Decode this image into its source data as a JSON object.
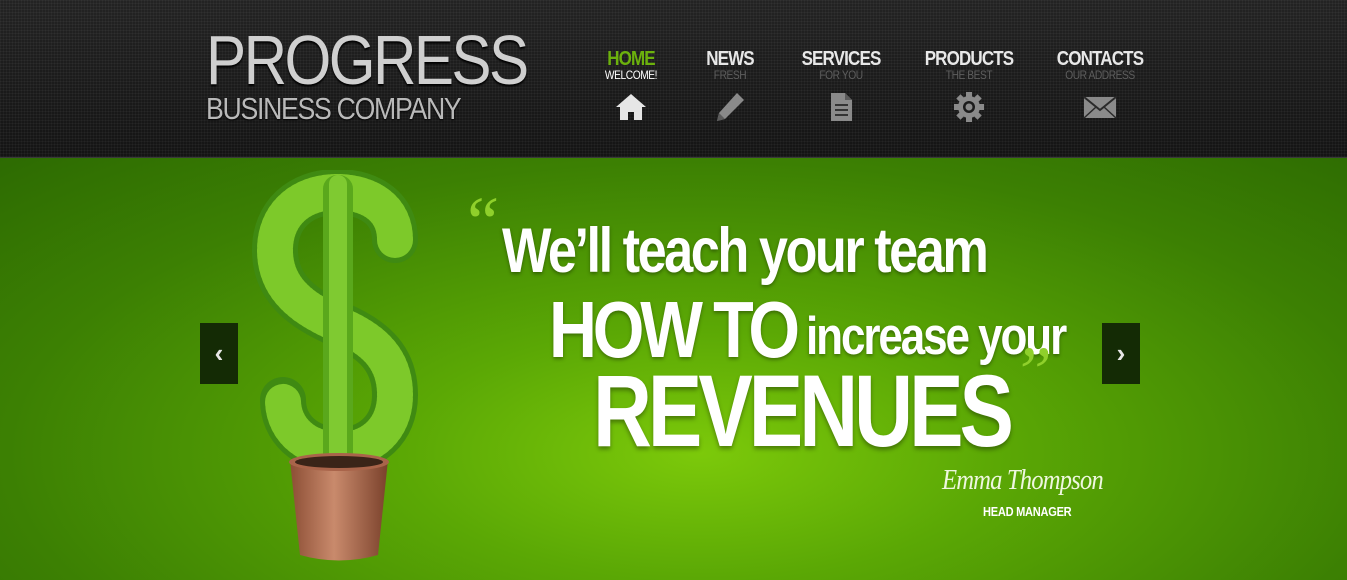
{
  "logo": {
    "title": "PROGRESS",
    "subtitle": "BUSINESS COMPANY"
  },
  "nav": {
    "items": [
      {
        "label": "HOME",
        "sub": "WELCOME!",
        "icon": "home-icon",
        "active": true
      },
      {
        "label": "NEWS",
        "sub": "FRESH",
        "icon": "pencil-icon",
        "active": false
      },
      {
        "label": "SERVICES",
        "sub": "FOR YOU",
        "icon": "document-icon",
        "active": false
      },
      {
        "label": "PRODUCTS",
        "sub": "THE BEST",
        "icon": "gear-icon",
        "active": false
      },
      {
        "label": "CONTACTS",
        "sub": "OUR ADDRESS",
        "icon": "envelope-icon",
        "active": false
      }
    ]
  },
  "slider": {
    "prev_label": "‹",
    "next_label": "›",
    "quote_open": "“",
    "quote_close": "”",
    "line1": "We’ll teach your team",
    "line2_big": "HOW TO",
    "line2_small": "increase your",
    "line3": "REVENUES",
    "author_name": "Emma Thompson",
    "author_role": "HEAD MANAGER"
  },
  "colors": {
    "accent": "#6cb10d",
    "hero_green": "#5ba805",
    "header_dark": "#1b1b1b"
  }
}
